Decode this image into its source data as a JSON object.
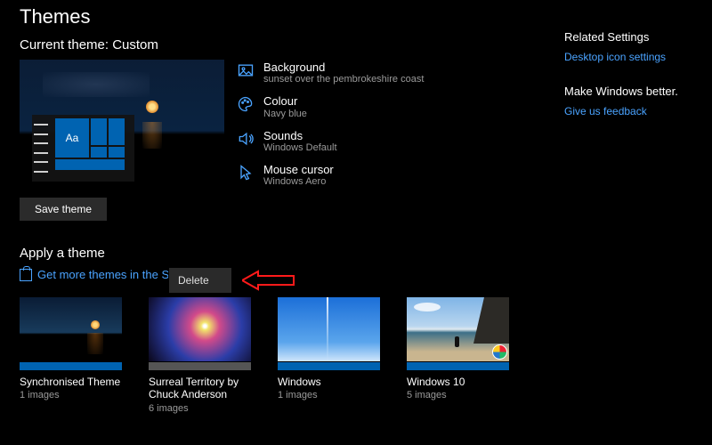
{
  "page": {
    "title": "Themes",
    "current_heading": "Current theme: Custom",
    "apply_heading": "Apply a theme"
  },
  "preview": {
    "tile_label": "Aa"
  },
  "properties": {
    "background": {
      "label": "Background",
      "value": "sunset over the pembrokeshire coast"
    },
    "colour": {
      "label": "Colour",
      "value": "Navy blue"
    },
    "sounds": {
      "label": "Sounds",
      "value": "Windows Default"
    },
    "cursor": {
      "label": "Mouse cursor",
      "value": "Windows Aero"
    }
  },
  "buttons": {
    "save": "Save theme"
  },
  "store_link": "Get more themes in the Store",
  "context_menu": {
    "delete": "Delete"
  },
  "themes": [
    {
      "name": "Synchronised Theme",
      "count": "1 images",
      "bar": "bar-blue"
    },
    {
      "name": "Surreal Territory by Chuck Anderson",
      "count": "6 images",
      "bar": "bar-grey"
    },
    {
      "name": "Windows",
      "count": "1 images",
      "bar": "bar-blue"
    },
    {
      "name": "Windows 10",
      "count": "5 images",
      "bar": "bar-blue"
    }
  ],
  "right": {
    "related_head": "Related Settings",
    "related_link": "Desktop icon settings",
    "better_head": "Make Windows better.",
    "better_link": "Give us feedback"
  }
}
